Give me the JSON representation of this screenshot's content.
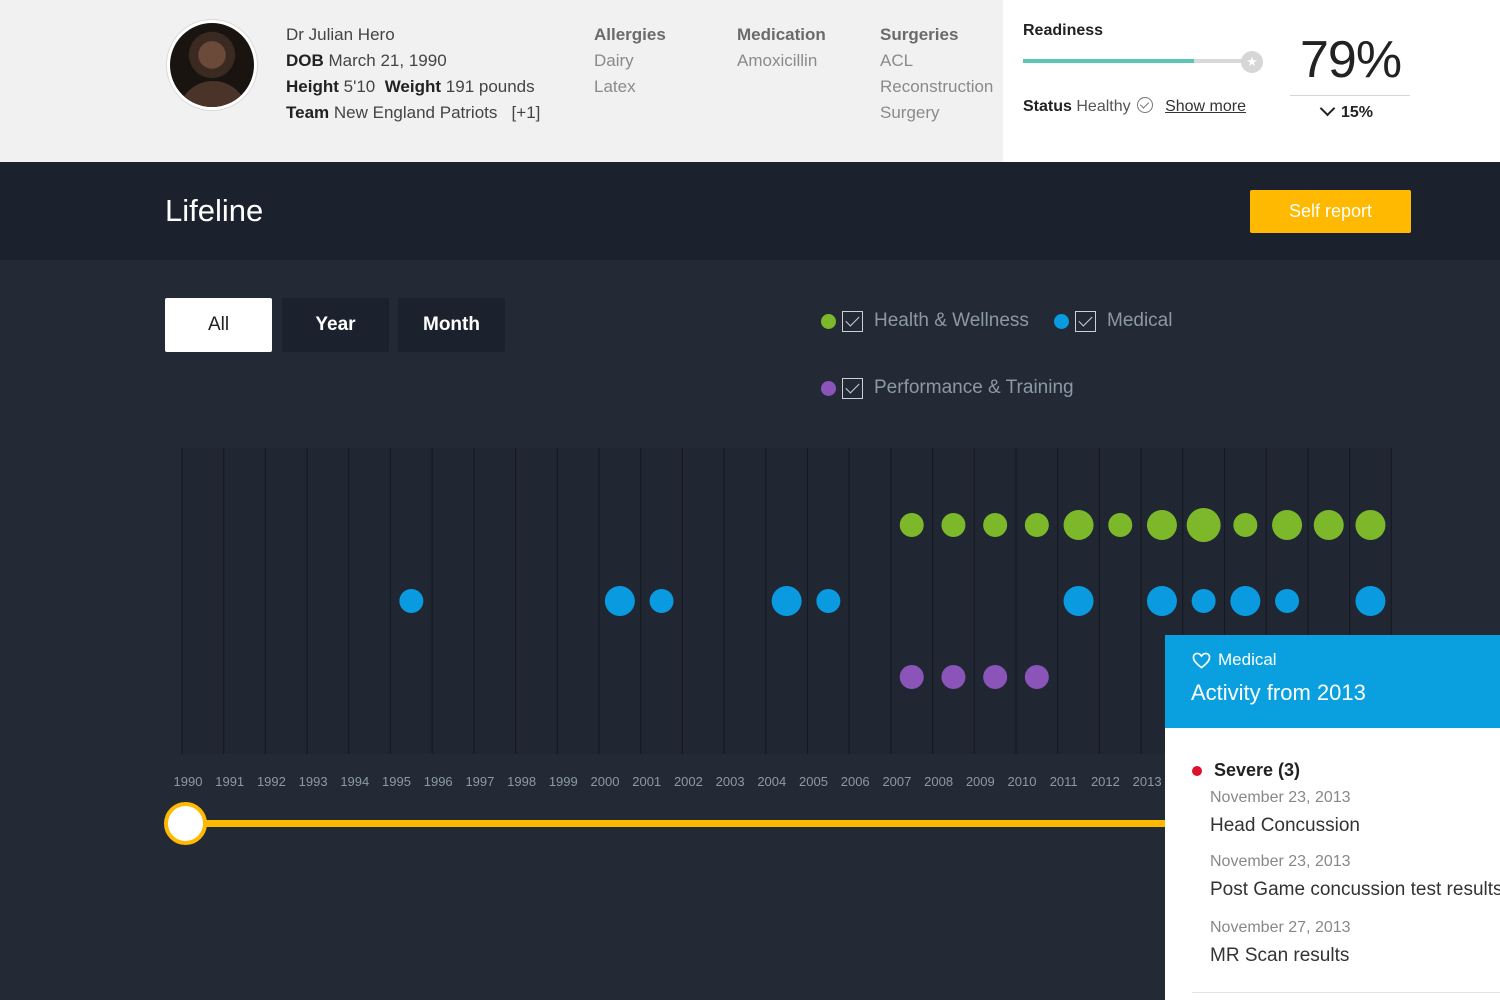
{
  "profile": {
    "name": "Dr Julian Hero",
    "dob_label": "DOB",
    "dob": "March 21, 1990",
    "height_label": "Height",
    "height": "5'10",
    "weight_label": "Weight",
    "weight": "191 pounds",
    "team_label": "Team",
    "team": "New England Patriots",
    "team_more": "[+1]"
  },
  "allergies": {
    "heading": "Allergies",
    "items": [
      "Dairy",
      "Latex"
    ]
  },
  "medication": {
    "heading": "Medication",
    "items": [
      "Amoxicillin"
    ]
  },
  "surgeries": {
    "heading": "Surgeries",
    "items": [
      "ACL",
      "Reconstruction",
      "Surgery"
    ]
  },
  "readiness": {
    "title": "Readiness",
    "level": 0.75,
    "status_label": "Status",
    "status": "Healthy",
    "show_more": "Show more",
    "percent": "79%",
    "delta": "15%",
    "track_color": "#5ac6b3"
  },
  "lifeline": {
    "title": "Lifeline",
    "self_report": "Self report"
  },
  "tabs": [
    {
      "label": "All",
      "selected": true
    },
    {
      "label": "Year",
      "selected": false
    },
    {
      "label": "Month",
      "selected": false
    }
  ],
  "legend": [
    {
      "label": "Health & Wellness",
      "color": "#7db82b",
      "checked": true
    },
    {
      "label": "Medical",
      "color": "#0a9ae0",
      "checked": true
    },
    {
      "label": "Performance & Training",
      "color": "#8a54b8",
      "checked": true
    }
  ],
  "timeline": {
    "years": [
      "1990",
      "1991",
      "1992",
      "1993",
      "1994",
      "1995",
      "1996",
      "1997",
      "1998",
      "1999",
      "2000",
      "2001",
      "2002",
      "2003",
      "2004",
      "2005",
      "2006",
      "2007",
      "2008",
      "2009",
      "2010",
      "2011",
      "2012",
      "2013"
    ],
    "series": [
      {
        "category": "Health & Wellness",
        "color": "#7db82b",
        "events": [
          {
            "year": 2007,
            "size": 1
          },
          {
            "year": 2008,
            "size": 1
          },
          {
            "year": 2009,
            "size": 1
          },
          {
            "year": 2010,
            "size": 1
          },
          {
            "year": 2011,
            "size": 2
          },
          {
            "year": 2012,
            "size": 1
          },
          {
            "year": 2013,
            "size": 2
          },
          {
            "year": 2014,
            "size": 3
          },
          {
            "year": 2015,
            "size": 1
          },
          {
            "year": 2016,
            "size": 2
          },
          {
            "year": 2017,
            "size": 2
          },
          {
            "year": 2018,
            "size": 2
          }
        ]
      },
      {
        "category": "Medical",
        "color": "#0a9ae0",
        "events": [
          {
            "year": 1995,
            "size": 1
          },
          {
            "year": 2000,
            "size": 2
          },
          {
            "year": 2001,
            "size": 1
          },
          {
            "year": 2004,
            "size": 2
          },
          {
            "year": 2005,
            "size": 1
          },
          {
            "year": 2011,
            "size": 2
          },
          {
            "year": 2013,
            "size": 2
          },
          {
            "year": 2014,
            "size": 1
          },
          {
            "year": 2015,
            "size": 2
          },
          {
            "year": 2016,
            "size": 1
          },
          {
            "year": 2018,
            "size": 2
          }
        ]
      },
      {
        "category": "Performance & Training",
        "color": "#8a54b8",
        "events": [
          {
            "year": 2007,
            "size": 1
          },
          {
            "year": 2008,
            "size": 1
          },
          {
            "year": 2009,
            "size": 1
          },
          {
            "year": 2010,
            "size": 1
          }
        ]
      }
    ]
  },
  "popup": {
    "category": "Medical",
    "title": "Activity from 2013",
    "severity": "Severe (3)",
    "severity_color": "#e0102a",
    "entries": [
      {
        "date": "November 23, 2013",
        "text": "Head Concussion"
      },
      {
        "date": "November 23, 2013",
        "text": "Post Game concussion test results"
      },
      {
        "date": "November 27, 2013",
        "text": "MR Scan results"
      }
    ]
  }
}
